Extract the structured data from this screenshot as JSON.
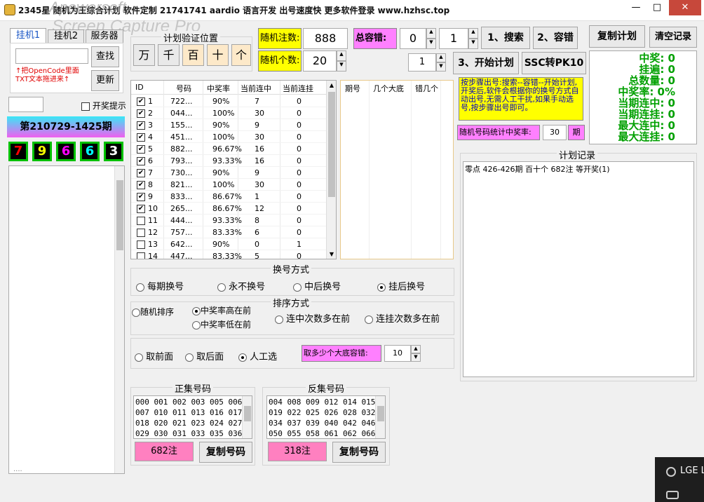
{
  "window": {
    "title": "2345星  随机为王综合计划  软件定制 21741741  aardio 语言开发  出号速度快  更多软件登录  www.hzhsc.top",
    "watermark_line1": "Apowersoft",
    "watermark_line2": "Screen Capture Pro",
    "minimize": "—",
    "maximize": "□",
    "close": "✕"
  },
  "left": {
    "tabs": [
      "挂机1",
      "挂机2",
      "服务器"
    ],
    "search_label": "查找",
    "update_label": "更新",
    "hint": "↑把OpenCode里面TXT文本拖进来↑",
    "lottery_notify": "开奖提示",
    "period": "第210729-1425期",
    "digits": [
      "7",
      "9",
      "6",
      "6",
      "3"
    ],
    "digit_colors": [
      "#ff0000",
      "#ffff00",
      "#ff00ff",
      "#00ffff",
      "#ffffff"
    ],
    "list_bottom_partial": "...."
  },
  "plan_group": {
    "title": "计划验证位置",
    "positions": [
      "万",
      "千",
      "百",
      "十",
      "个"
    ],
    "active": [
      false,
      false,
      true,
      true,
      true
    ]
  },
  "random": {
    "count_label": "随机注数:",
    "count_value": "888",
    "num_label": "随机个数:",
    "num_value": "20",
    "tolerance_label": "总容错:",
    "tolerance_from": "0",
    "tolerance_to": "1",
    "btn_search": "1、搜索",
    "btn_tolerance": "2、容错",
    "btn_copy_plan": "复制计划",
    "btn_clear": "清空记录",
    "small_value": "1",
    "btn_start": "3、开始计划",
    "btn_ssc": "SSC转PK10"
  },
  "stats": {
    "lines": [
      "中奖: 0",
      "挂遍: 0",
      "总数量: 0",
      "中奖率: 0%",
      "当期连中: 0",
      "当期连挂: 0",
      "最大连中: 0",
      "最大连挂: 0"
    ]
  },
  "table": {
    "headers": [
      "ID",
      "号码",
      "中奖率",
      "当前连中",
      "当前连挂"
    ],
    "rows": [
      {
        "id": "1",
        "checked": true,
        "num": "722...",
        "rate": "90%",
        "win": "7",
        "lose": "0"
      },
      {
        "id": "2",
        "checked": true,
        "num": "044...",
        "rate": "100%",
        "win": "30",
        "lose": "0"
      },
      {
        "id": "3",
        "checked": true,
        "num": "155...",
        "rate": "90%",
        "win": "9",
        "lose": "0"
      },
      {
        "id": "4",
        "checked": true,
        "num": "451...",
        "rate": "100%",
        "win": "30",
        "lose": "0"
      },
      {
        "id": "5",
        "checked": true,
        "num": "882...",
        "rate": "96.67%",
        "win": "16",
        "lose": "0"
      },
      {
        "id": "6",
        "checked": true,
        "num": "793...",
        "rate": "93.33%",
        "win": "16",
        "lose": "0"
      },
      {
        "id": "7",
        "checked": true,
        "num": "730...",
        "rate": "90%",
        "win": "9",
        "lose": "0"
      },
      {
        "id": "8",
        "checked": true,
        "num": "821...",
        "rate": "100%",
        "win": "30",
        "lose": "0"
      },
      {
        "id": "9",
        "checked": true,
        "num": "833...",
        "rate": "86.67%",
        "win": "1",
        "lose": "0"
      },
      {
        "id": "10",
        "checked": true,
        "num": "265...",
        "rate": "86.67%",
        "win": "12",
        "lose": "0"
      },
      {
        "id": "11",
        "checked": false,
        "num": "444...",
        "rate": "93.33%",
        "win": "8",
        "lose": "0"
      },
      {
        "id": "12",
        "checked": false,
        "num": "757...",
        "rate": "83.33%",
        "win": "6",
        "lose": "0"
      },
      {
        "id": "13",
        "checked": false,
        "num": "642...",
        "rate": "90%",
        "win": "0",
        "lose": "1"
      },
      {
        "id": "14",
        "checked": false,
        "num": "447...",
        "rate": "83.33%",
        "win": "5",
        "lose": "0"
      }
    ]
  },
  "table2": {
    "headers": [
      "期号",
      "几个大底",
      "错几个"
    ]
  },
  "note": {
    "text": "按步骤出号:搜索--容错--开始计划,开奖后,软件会根据你的换号方式自动出号,无需人工干扰,如果手动选号,按步骤出号即可。",
    "rate_label": "随机号码统计中奖率:",
    "rate_value": "30",
    "rate_unit": "期"
  },
  "record": {
    "title": "计划记录",
    "text": "零点 426-426期 百十个 682注  等开奖(1)"
  },
  "change_mode": {
    "title": "换号方式",
    "options": [
      "每期换号",
      "永不换号",
      "中后换号",
      "挂后换号"
    ],
    "selected": 3
  },
  "sort_mode": {
    "title": "排序方式",
    "opt_random": "随机排序",
    "opt_high": "中奖率高在前",
    "opt_low": "中奖率低在前",
    "opt_win": "连中次数多在前",
    "opt_lose": "连挂次数多在前"
  },
  "take": {
    "front": "取前面",
    "back": "取后面",
    "manual": "人工选",
    "label": "取多少个大底容错:",
    "value": "10"
  },
  "positive": {
    "title": "正集号码",
    "lines": [
      "000 001 002 003 005 006",
      "007 010 011 013 016 017",
      "018 020 021 023 024 027",
      "029 030 031 033 035 036"
    ],
    "count": "682注",
    "copy": "复制号码"
  },
  "negative": {
    "title": "反集号码",
    "lines": [
      "004 008 009 012 014 015",
      "019 022 025 026 028 032",
      "034 037 039 040 042 046",
      "050 055 058 061 062 066"
    ],
    "count": "318注",
    "copy": "复制号码"
  },
  "taskbar": {
    "label": "LGE L"
  }
}
